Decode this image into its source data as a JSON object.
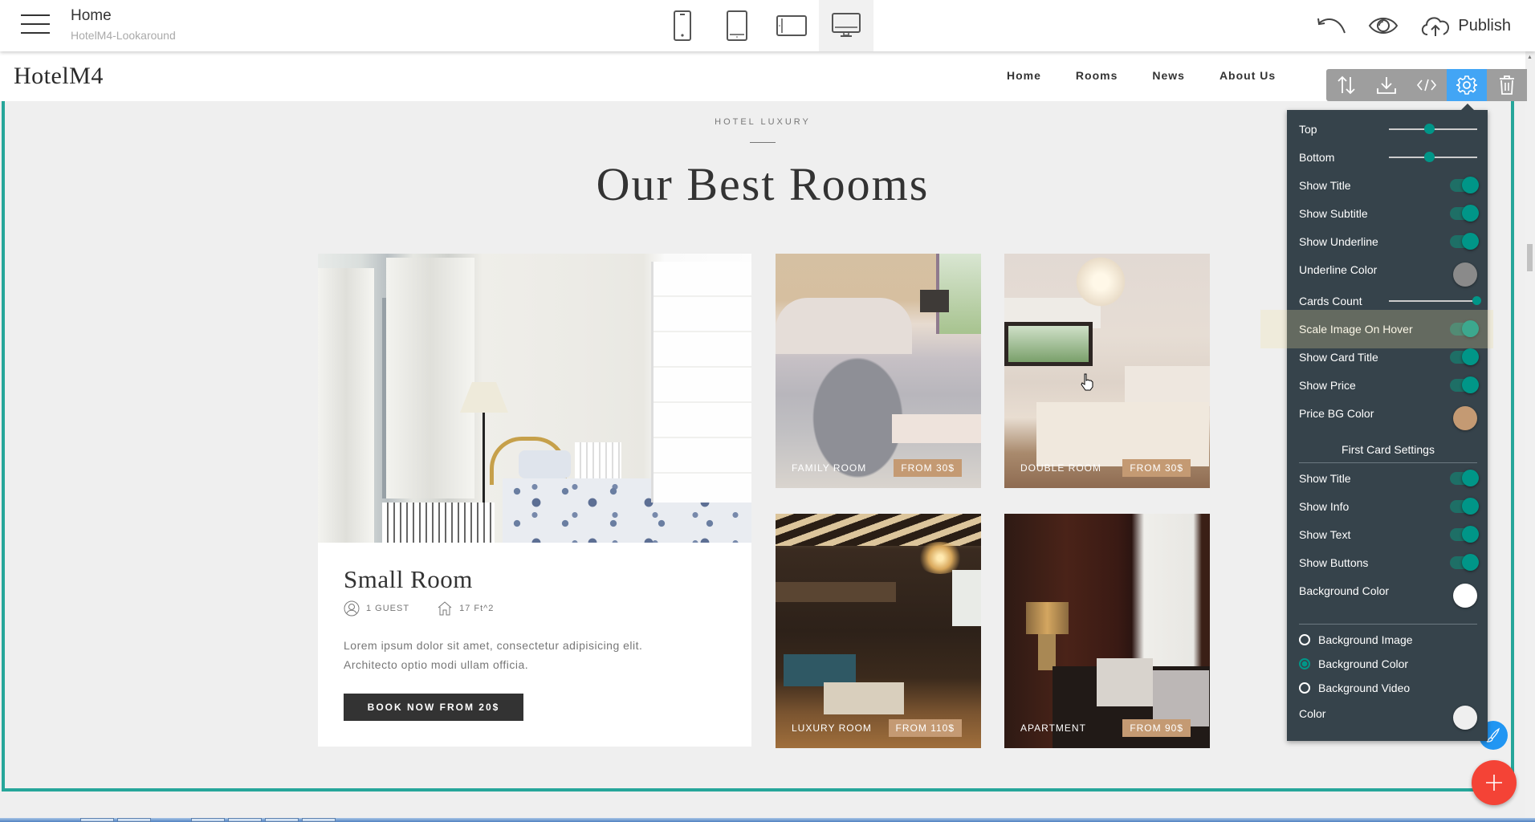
{
  "editor": {
    "page_title": "Home",
    "project_name": "HotelM4-Lookaround",
    "devices": [
      {
        "name": "phone",
        "active": false
      },
      {
        "name": "tablet",
        "active": false
      },
      {
        "name": "tablet-landscape",
        "active": false
      },
      {
        "name": "desktop",
        "active": true
      }
    ],
    "actions": {
      "undo_icon": "undo-icon",
      "preview_icon": "eye-icon",
      "publish_label": "Publish"
    }
  },
  "site": {
    "logo": "HotelM4",
    "nav": [
      "Home",
      "Rooms",
      "News",
      "About Us"
    ]
  },
  "section": {
    "subtitle": "HOTEL LUXURY",
    "title": "Our Best Rooms",
    "first_card": {
      "title": "Small Room",
      "guests": "1 GUEST",
      "area": "17 Ft^2",
      "text_line1": "Lorem ipsum dolor sit amet, consectetur adipisicing elit.",
      "text_line2": "Architecto optio modi ullam officia.",
      "button": "BOOK NOW FROM 20$"
    },
    "cards": [
      {
        "name": "FAMILY ROOM",
        "price": "FROM 30$"
      },
      {
        "name": "DOUBLE ROOM",
        "price": "FROM 30$"
      },
      {
        "name": "LUXURY ROOM",
        "price": "FROM 110$"
      },
      {
        "name": "APARTMENT",
        "price": "FROM 90$"
      }
    ]
  },
  "block_toolbar": {
    "buttons": [
      "move-icon",
      "download-icon",
      "code-icon",
      "gear-icon",
      "trash-icon"
    ],
    "active": "gear-icon"
  },
  "settings": {
    "top": {
      "label": "Top",
      "value": 0.45
    },
    "bottom": {
      "label": "Bottom",
      "value": 0.45
    },
    "show_title": {
      "label": "Show Title",
      "on": true
    },
    "show_subtitle": {
      "label": "Show Subtitle",
      "on": true
    },
    "show_underline": {
      "label": "Show Underline",
      "on": true
    },
    "underline_color": {
      "label": "Underline Color",
      "color": "#8a8a8a"
    },
    "cards_count": {
      "label": "Cards Count",
      "value": 1.0
    },
    "scale_image": {
      "label": "Scale Image On Hover",
      "on": true
    },
    "show_card_title": {
      "label": "Show Card Title",
      "on": true
    },
    "show_price": {
      "label": "Show Price",
      "on": true
    },
    "price_bg_color": {
      "label": "Price BG Color",
      "color": "#c49a73"
    },
    "first_card_heading": "First Card Settings",
    "fc_show_title": {
      "label": "Show Title",
      "on": true
    },
    "fc_show_info": {
      "label": "Show Info",
      "on": true
    },
    "fc_show_text": {
      "label": "Show Text",
      "on": true
    },
    "fc_show_buttons": {
      "label": "Show Buttons",
      "on": true
    },
    "fc_bg_color": {
      "label": "Background Color",
      "color": "#ffffff"
    },
    "bg_options": [
      {
        "label": "Background Image",
        "selected": false
      },
      {
        "label": "Background Color",
        "selected": true
      },
      {
        "label": "Background Video",
        "selected": false
      }
    ],
    "color": {
      "label": "Color",
      "color": "#efefef"
    }
  },
  "colors": {
    "accent": "#26a69a",
    "toolbar_active": "#42a5f5",
    "panel_bg": "#36434b",
    "fab_add": "#f44336",
    "fab_edit": "#2196f3",
    "price_bg": "#c49a73"
  }
}
